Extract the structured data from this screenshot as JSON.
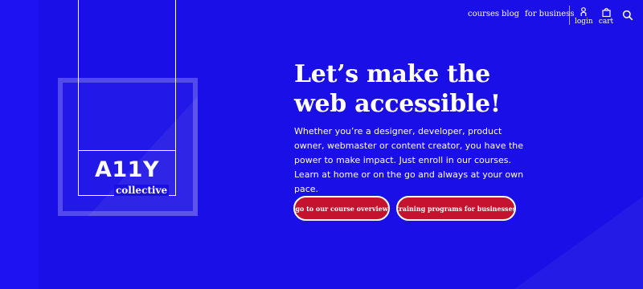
{
  "nav": {
    "links": [
      "courses",
      "blog",
      "for business"
    ],
    "login_label": "login",
    "cart_label": "cart"
  },
  "logo": {
    "main": "A11Y",
    "sub": "collective"
  },
  "hero": {
    "title_line1": "Let’s make the",
    "title_line2": "web accessible!",
    "body": "Whether you’re a designer, developer, product owner, webmaster or content creator, you have the power to make impact. Just enroll in our courses. Learn at home or on the go and always at your own pace.",
    "buttons": [
      "go to our course overview",
      "training programs for businesses"
    ]
  },
  "colors": {
    "background": "#1a0fe6",
    "button": "#c4122f",
    "text": "#ffffff"
  }
}
